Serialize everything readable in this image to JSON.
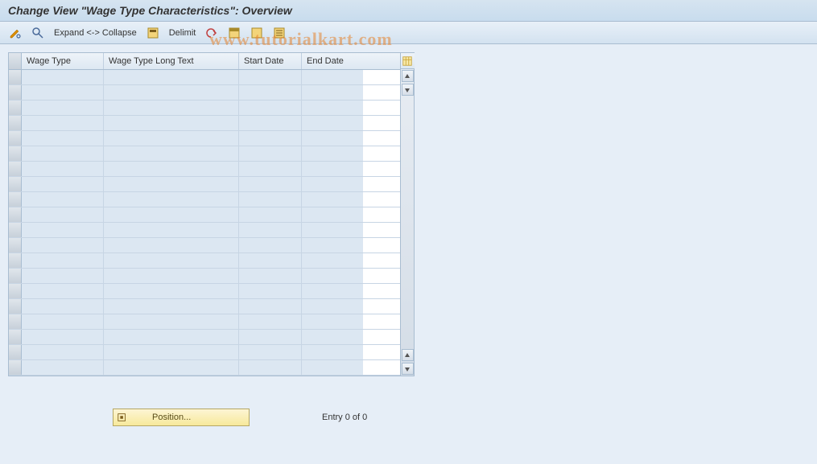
{
  "title": "Change View \"Wage Type Characteristics\": Overview",
  "toolbar": {
    "expand_collapse": "Expand <-> Collapse",
    "delimit": "Delimit"
  },
  "columns": {
    "wage_type": "Wage Type",
    "wage_type_long_text": "Wage Type Long Text",
    "start_date": "Start Date",
    "end_date": "End Date"
  },
  "rows": [
    {},
    {},
    {},
    {},
    {},
    {},
    {},
    {},
    {},
    {},
    {},
    {},
    {},
    {},
    {},
    {},
    {},
    {},
    {},
    {}
  ],
  "footer": {
    "position_label": "Position...",
    "entry_text": "Entry 0 of 0"
  },
  "watermark": "www.tutorialkart.com"
}
